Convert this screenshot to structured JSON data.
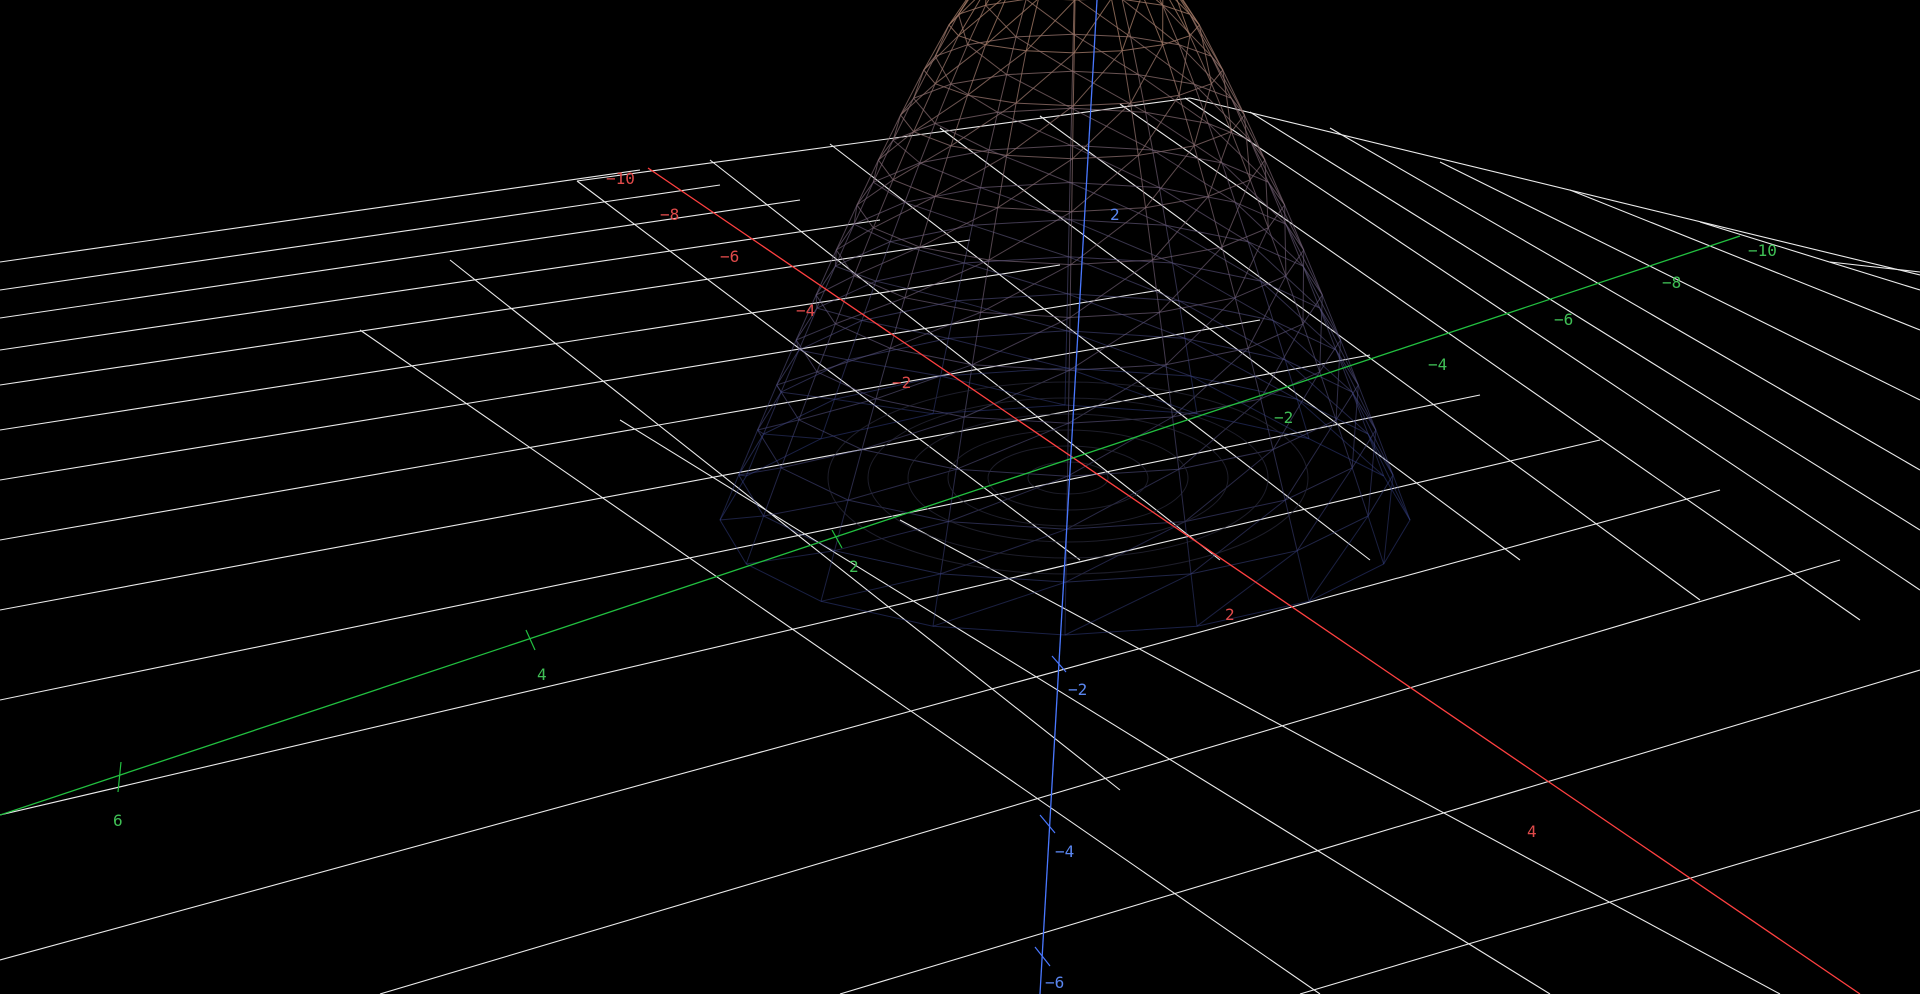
{
  "scene": {
    "background": "#000000",
    "grid_color": "#ffffff",
    "mesh_top_color": "#a57a62",
    "mesh_bottom_color": "#34408a"
  },
  "axes": {
    "x_axis": {
      "color": "#ff4040",
      "label_color": "#e04a4a",
      "ticks": [
        "−10",
        "−8",
        "−6",
        "−4",
        "−2",
        "2",
        "4"
      ]
    },
    "y_axis": {
      "color": "#22c040",
      "label_color": "#3fbf55",
      "ticks": [
        "−10",
        "−8",
        "−6",
        "−4",
        "−2",
        "2",
        "4",
        "6"
      ]
    },
    "z_axis": {
      "color": "#4a78ff",
      "label_color": "#5a86f0",
      "ticks": [
        "2",
        "−2",
        "−4",
        "−6"
      ]
    }
  }
}
